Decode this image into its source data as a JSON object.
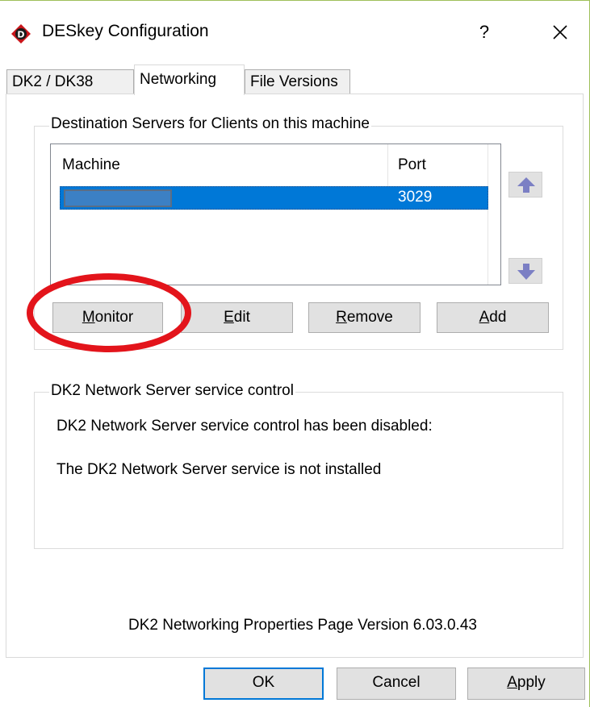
{
  "window": {
    "title": "DESkey Configuration",
    "help_label": "?",
    "close_icon": "close-icon",
    "app_icon": "deskey-diamond-icon"
  },
  "tabs": [
    {
      "label": "DK2 / DK38",
      "active": false
    },
    {
      "label": "Networking",
      "active": true
    },
    {
      "label": "File Versions",
      "active": false
    }
  ],
  "destination_group": {
    "legend": "Destination Servers for Clients on this machine",
    "columns": [
      "Machine",
      "Port"
    ],
    "rows": [
      {
        "machine": "",
        "port": "3029",
        "selected": true
      }
    ],
    "move_up_icon": "arrow-up-icon",
    "move_down_icon": "arrow-down-icon",
    "buttons": {
      "monitor": {
        "before": "",
        "accel": "M",
        "after": "onitor"
      },
      "edit": {
        "before": "",
        "accel": "E",
        "after": "dit"
      },
      "remove": {
        "before": "",
        "accel": "R",
        "after": "emove"
      },
      "add": {
        "before": "",
        "accel": "A",
        "after": "dd"
      }
    }
  },
  "service_group": {
    "legend": "DK2 Network Server service control",
    "line1": "DK2 Network Server service control has been disabled:",
    "line2": "The DK2 Network Server service is not installed"
  },
  "version_text": "DK2 Networking Properties Page Version 6.03.0.43",
  "dialog_buttons": {
    "ok": "OK",
    "cancel": "Cancel",
    "apply": {
      "before": "",
      "accel": "A",
      "after": "pply"
    }
  },
  "colors": {
    "selection": "#0078d7",
    "arrow": "#7b7fc4",
    "highlight": "#e3141b",
    "window_border": "#9fbf5a"
  }
}
